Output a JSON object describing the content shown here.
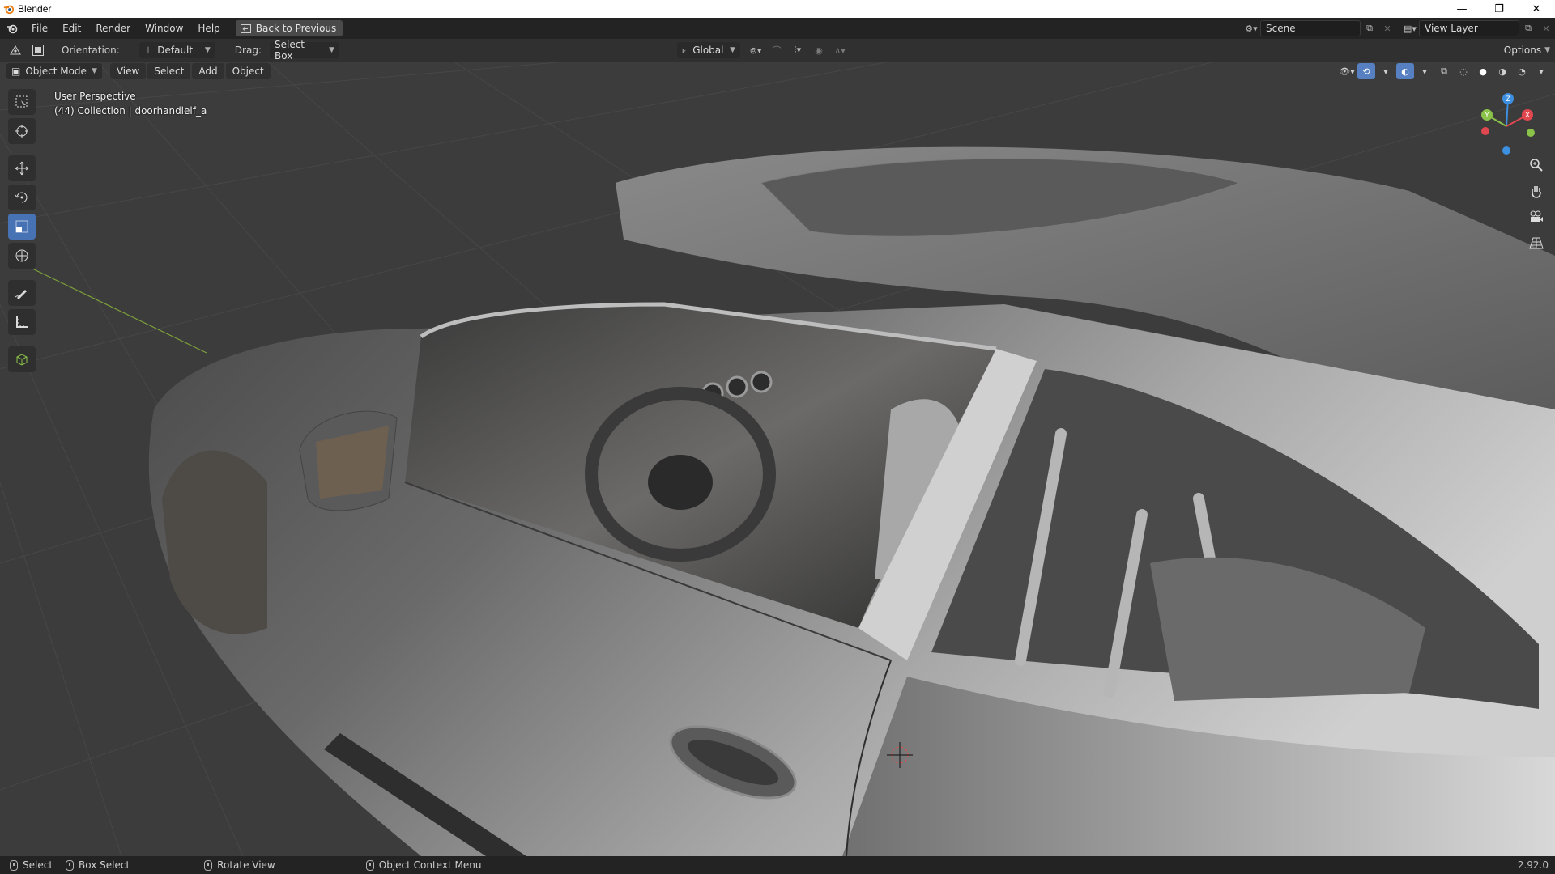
{
  "window": {
    "title": "Blender",
    "controls": {
      "minimize": "—",
      "maximize": "❐",
      "close": "✕"
    }
  },
  "topbar": {
    "menus": [
      "File",
      "Edit",
      "Render",
      "Window",
      "Help"
    ],
    "back_button": "Back to Previous",
    "scene": "Scene",
    "view_layer": "View Layer"
  },
  "toolheader": {
    "orientation_label": "Orientation:",
    "orientation_value": "Default",
    "drag_label": "Drag:",
    "drag_value": "Select Box",
    "transform_space": "Global",
    "options": "Options"
  },
  "viewport_header": {
    "mode": "Object Mode",
    "menus": [
      "View",
      "Select",
      "Add",
      "Object"
    ]
  },
  "viewport": {
    "view_name": "User Perspective",
    "collection_info": "(44) Collection | doorhandlelf_a"
  },
  "gizmo": {
    "x": "X",
    "y": "Y",
    "z": "Z"
  },
  "statusbar": {
    "select": "Select",
    "box_select": "Box Select",
    "rotate_view": "Rotate View",
    "context_menu": "Object Context Menu",
    "version": "2.92.0"
  },
  "colors": {
    "accent": "#4772b3",
    "x_axis": "#e0474f",
    "y_axis": "#8bc34a",
    "z_axis": "#3d8fe0"
  }
}
